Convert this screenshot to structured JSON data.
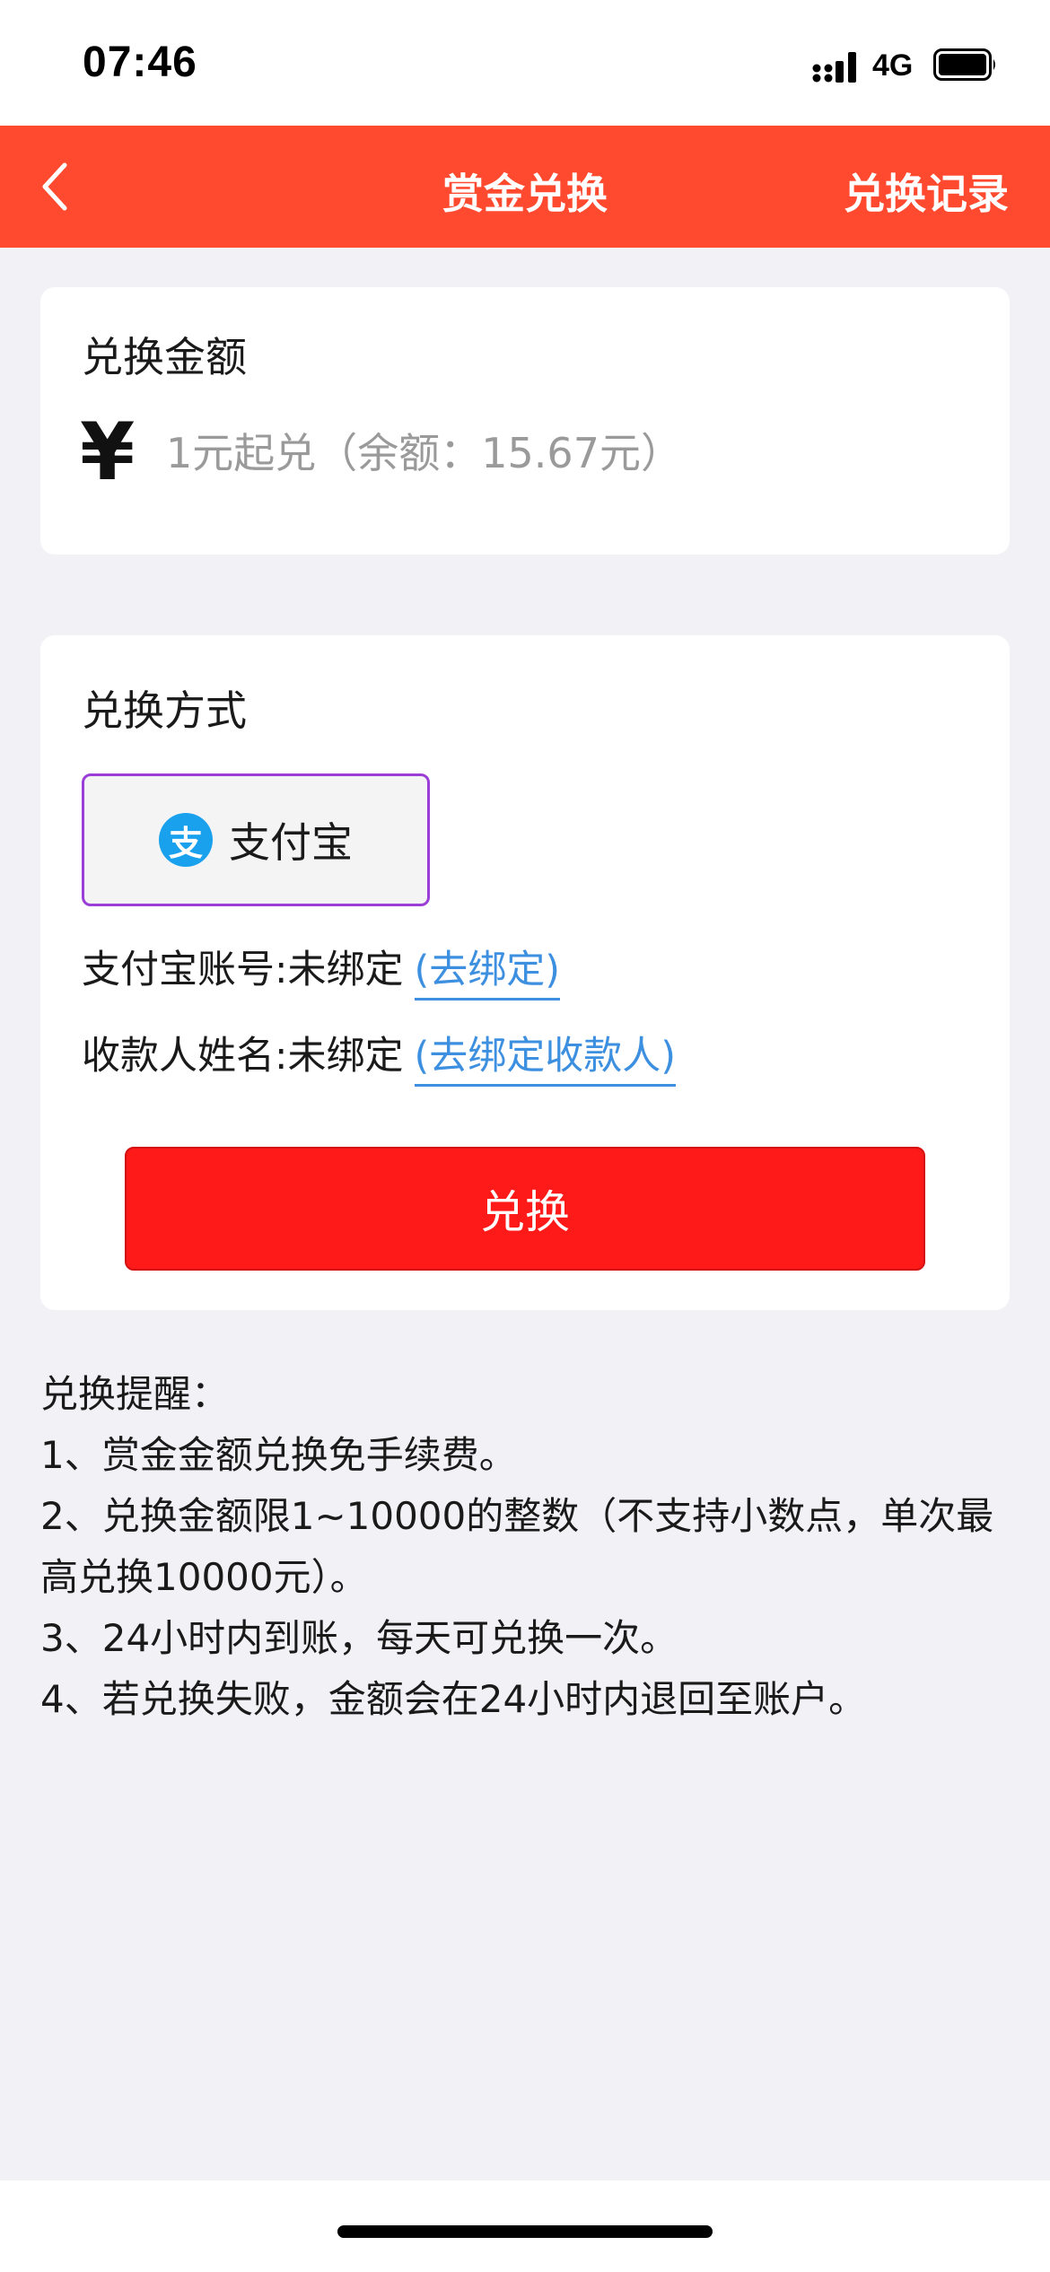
{
  "status_bar": {
    "time": "07:46",
    "network": "4G",
    "icons": [
      "signal-icon",
      "battery-icon"
    ]
  },
  "nav": {
    "title": "赏金兑换",
    "right_link": "兑换记录",
    "back_icon": "chevron-left-icon",
    "background_color": "#ff4a2f"
  },
  "amount_section": {
    "title": "兑换金额",
    "currency_symbol": "¥",
    "input_placeholder": "1元起兑（余额：15.67元）",
    "input_value": ""
  },
  "method_section": {
    "title": "兑换方式",
    "options": [
      {
        "label": "支付宝",
        "icon_glyph": "支",
        "icon": "alipay-icon",
        "selected": true
      }
    ],
    "account_row": {
      "label": "支付宝账号:未绑定",
      "link": "(去绑定)"
    },
    "name_row": {
      "label": "收款人姓名:未绑定",
      "link": "(去绑定收款人)"
    },
    "submit_label": "兑换",
    "submit_color": "#ff1a1a",
    "link_color": "#3d8fe0"
  },
  "tips": {
    "heading": "兑换提醒：",
    "items": [
      "1、赏金金额兑换免手续费。",
      "2、兑换金额限1~10000的整数（不支持小数点，单次最高兑换10000元）。",
      "3、24小时内到账，每天可兑换一次。",
      "4、若兑换失败，金额会在24小时内退回至账户。"
    ]
  }
}
